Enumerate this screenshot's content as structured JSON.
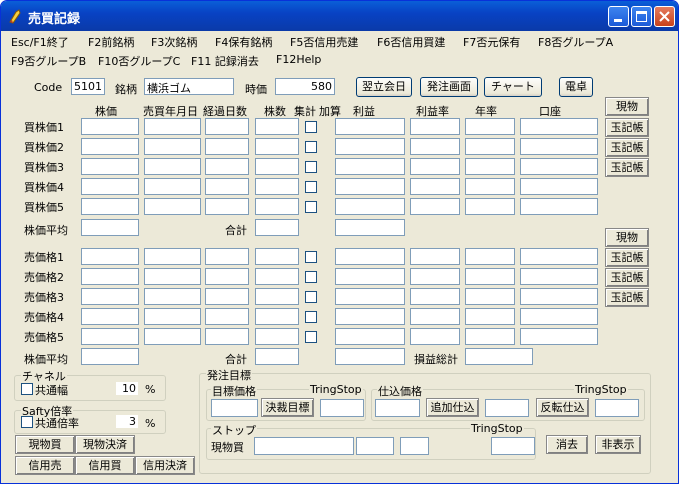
{
  "window": {
    "title": "売買記録"
  },
  "menu": {
    "row1": [
      "Esc/F1終了",
      "F2前銘柄",
      "F3次銘柄",
      "F4保有銘柄",
      "F5否信用売建",
      "F6否信用買建",
      "F7否元保有",
      "F8否グループA"
    ],
    "row2": [
      "F9否グループB",
      "F10否グループC",
      "F11 記録消去",
      "F12Help"
    ]
  },
  "header": {
    "code_label": "Code",
    "code_value": "5101",
    "meigara_label": "銘柄",
    "meigara_value": "横浜ゴム",
    "jika_label": "時価",
    "jika_value": "580",
    "buttons": [
      "翌立会日",
      "発注画面",
      "チャート",
      "電卓"
    ]
  },
  "columns": [
    "株価",
    "売買年月日",
    "経過日数",
    "株数",
    "集計",
    "加算",
    "利益",
    "利益率",
    "年率",
    "口座"
  ],
  "buy": {
    "rows": [
      "買株価1",
      "買株価2",
      "買株価3",
      "買株価4",
      "買株価5"
    ],
    "avg_label": "株価平均",
    "total_label": "合計",
    "side_buttons": [
      "現物",
      "玉記帳",
      "玉記帳",
      "玉記帳"
    ]
  },
  "sell": {
    "rows": [
      "売価格1",
      "売価格2",
      "売価格3",
      "売価格4",
      "売価格5"
    ],
    "avg_label": "株価平均",
    "total_label": "合計",
    "pl_total_label": "損益総計",
    "side_buttons": [
      "現物",
      "玉記帳",
      "玉記帳",
      "玉記帳"
    ]
  },
  "channel": {
    "title": "チャネル",
    "check_label": "共通幅",
    "value": "10",
    "unit": "%"
  },
  "safety": {
    "title": "Safty倍率",
    "check_label": "共通倍率",
    "value": "3",
    "unit": "%"
  },
  "trade_buttons": [
    "現物買",
    "現物決済",
    "信用売",
    "信用買",
    "信用決済"
  ],
  "order": {
    "title": "発注目標",
    "target": {
      "title": "目標価格",
      "tring": "TringStop",
      "button": "決裁目標"
    },
    "buyin": {
      "title": "仕込価格",
      "tring": "TringStop",
      "add_button": "追加仕込",
      "reverse_button": "反転仕込"
    },
    "stop": {
      "title": "ストップ",
      "tring": "TringStop",
      "label": "現物買"
    },
    "buttons": [
      "消去",
      "非表示"
    ]
  }
}
